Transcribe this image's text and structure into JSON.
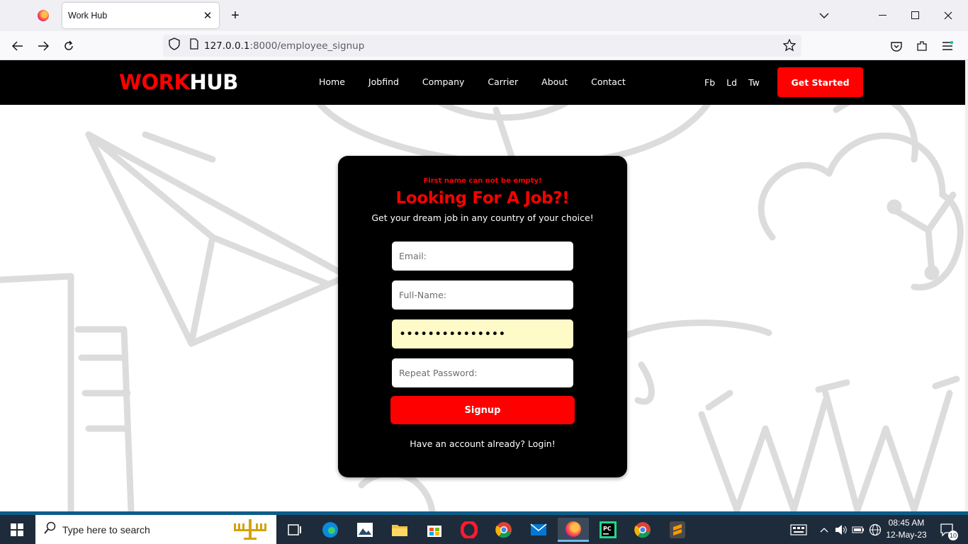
{
  "browser": {
    "tab_title": "Work Hub",
    "tab_close": "✕",
    "new_tab": "+",
    "url_host": "127.0.0.1",
    "url_path": ":8000/employee_signup",
    "icons": [
      "back-icon",
      "forward-icon",
      "reload-icon",
      "shield-icon",
      "page-icon",
      "bookmark-star-icon",
      "pocket-icon",
      "extensions-icon",
      "menu-icon"
    ]
  },
  "site": {
    "logo_part1": "WORK",
    "logo_part2": "HUB",
    "menu": [
      "Home",
      "Jobfind",
      "Company",
      "Carrier",
      "About",
      "Contact"
    ],
    "social": [
      "Fb",
      "Ld",
      "Tw"
    ],
    "cta": "Get Started"
  },
  "form": {
    "error": "First name can not be empty!",
    "heading": "Looking For A Job?!",
    "subheading": "Get your dream job in any country of your choice!",
    "email_placeholder": "Email:",
    "fullname_placeholder": "Full-Name:",
    "password_value": "•••••••••••••••",
    "repeat_placeholder": "Repeat Password:",
    "signup_label": "Signup",
    "login_text": "Have an account already? Login!"
  },
  "taskbar": {
    "search_placeholder": "Type here to search",
    "time": "08:45 AM",
    "date": "12-May-23",
    "notifications": "10"
  },
  "colors": {
    "brand_red": "#ff0000",
    "header_bg": "#000000",
    "autofill_bg": "#fffbc8"
  }
}
